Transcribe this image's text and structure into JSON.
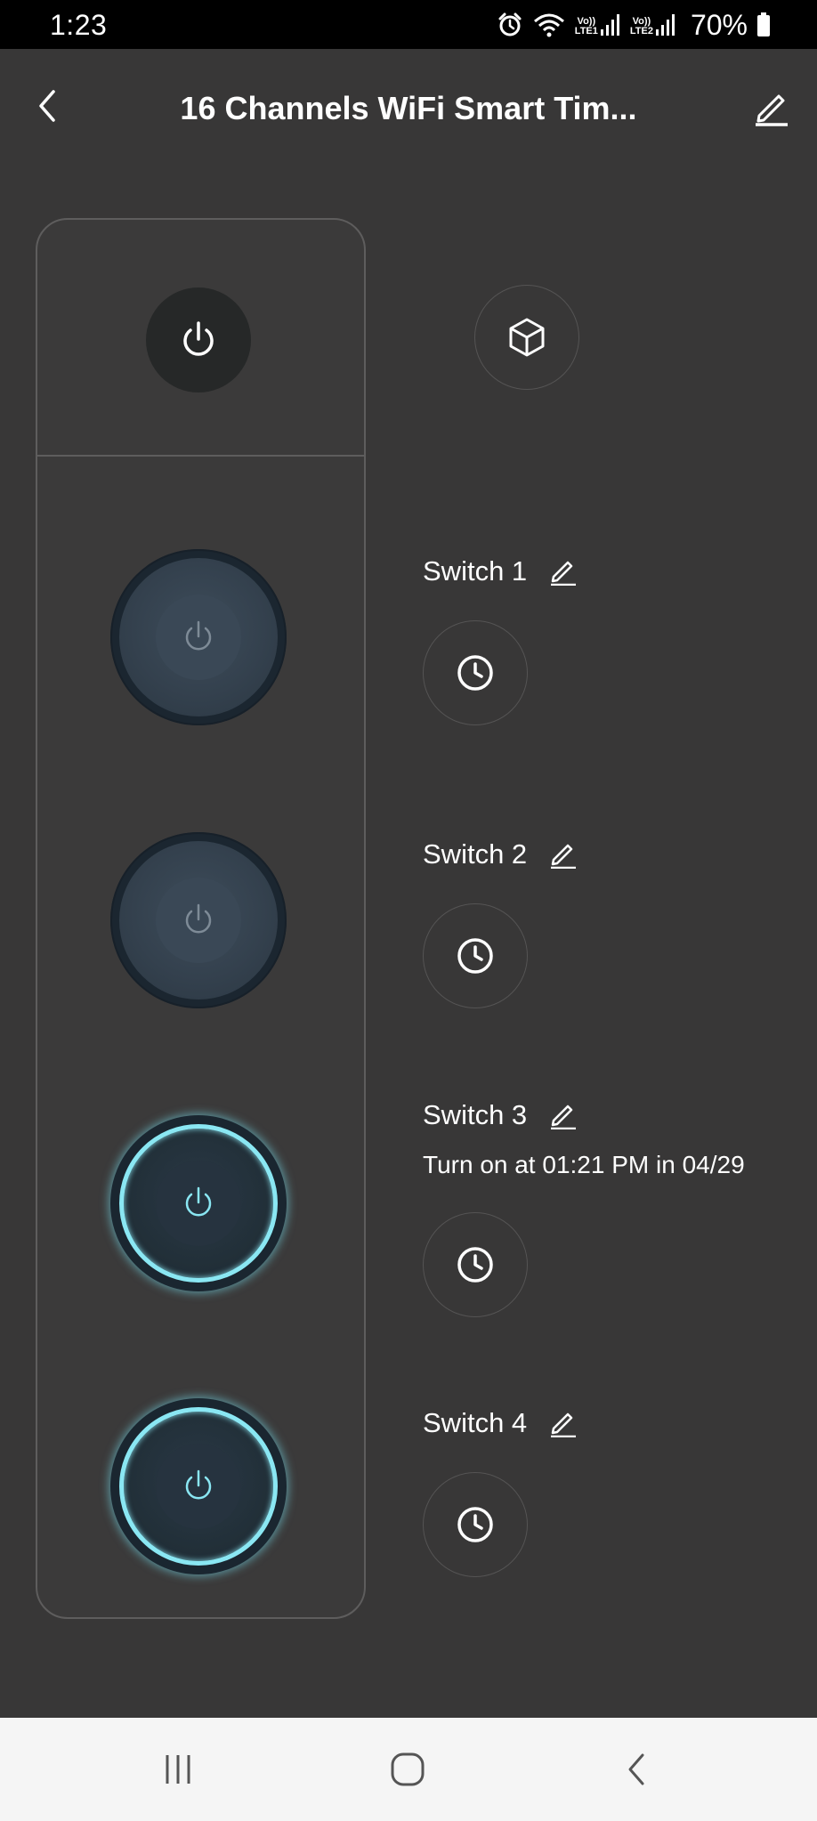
{
  "status_bar": {
    "time": "1:23",
    "sim1_label": "LTE1",
    "sim2_label": "LTE2",
    "volte1_label": "Vo))",
    "volte2_label": "Vo))",
    "battery": "70%"
  },
  "header": {
    "title": "16 Channels WiFi Smart Tim..."
  },
  "switches": [
    {
      "name": "Switch 1",
      "state": "off",
      "schedule": ""
    },
    {
      "name": "Switch 2",
      "state": "off",
      "schedule": ""
    },
    {
      "name": "Switch 3",
      "state": "on",
      "schedule": "Turn on at 01:21 PM in 04/29"
    },
    {
      "name": "Switch 4",
      "state": "on",
      "schedule": ""
    }
  ],
  "icons": {
    "back": "chevron-left-icon",
    "edit": "pencil-icon",
    "master": "power-icon",
    "scene": "cube-icon",
    "timer": "clock-icon"
  },
  "colors": {
    "background": "#383737",
    "panel_border": "#5e5d5d",
    "knob_on_glow": "#8ae7f3",
    "knob_off": "#34414e",
    "nav_bar": "#f5f5f5"
  }
}
